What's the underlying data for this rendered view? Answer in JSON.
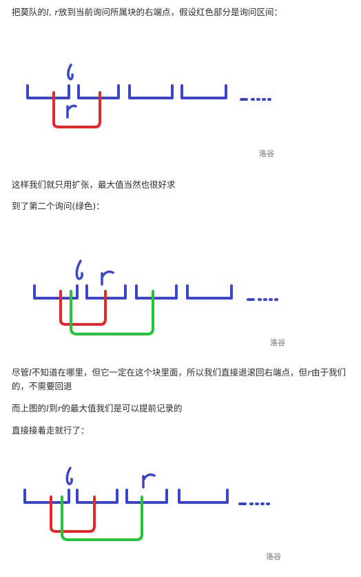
{
  "para1": {
    "before": "把莫队的",
    "math1": "l, r",
    "after": "放到当前询问所属块的右端点，假设红色部分是询问区间："
  },
  "para2": "这样我们就只用扩张，最大值当然也很好求",
  "para3": "到了第二个询问(绿色)：",
  "para4": {
    "t1": "尽管",
    "m1": "l",
    "t2": "不知道在哪里，但它一定在这个块里面，所以我们直接退滚回右端点，但",
    "m2": "r",
    "t3": "由于我们",
    "line2": "的，不需要回退"
  },
  "para5": {
    "t1": "而上图的",
    "m1": "l",
    "t2": "到",
    "m2": "r",
    "t3": "的最大值我们是可以提前记录的"
  },
  "para6": "直接接着走就行了：",
  "watermark": "洛谷",
  "colors": {
    "blocks": "#3a45c8",
    "query1": "#e5262a",
    "query2": "#23c43a",
    "watermark": "#9a9a9a"
  }
}
